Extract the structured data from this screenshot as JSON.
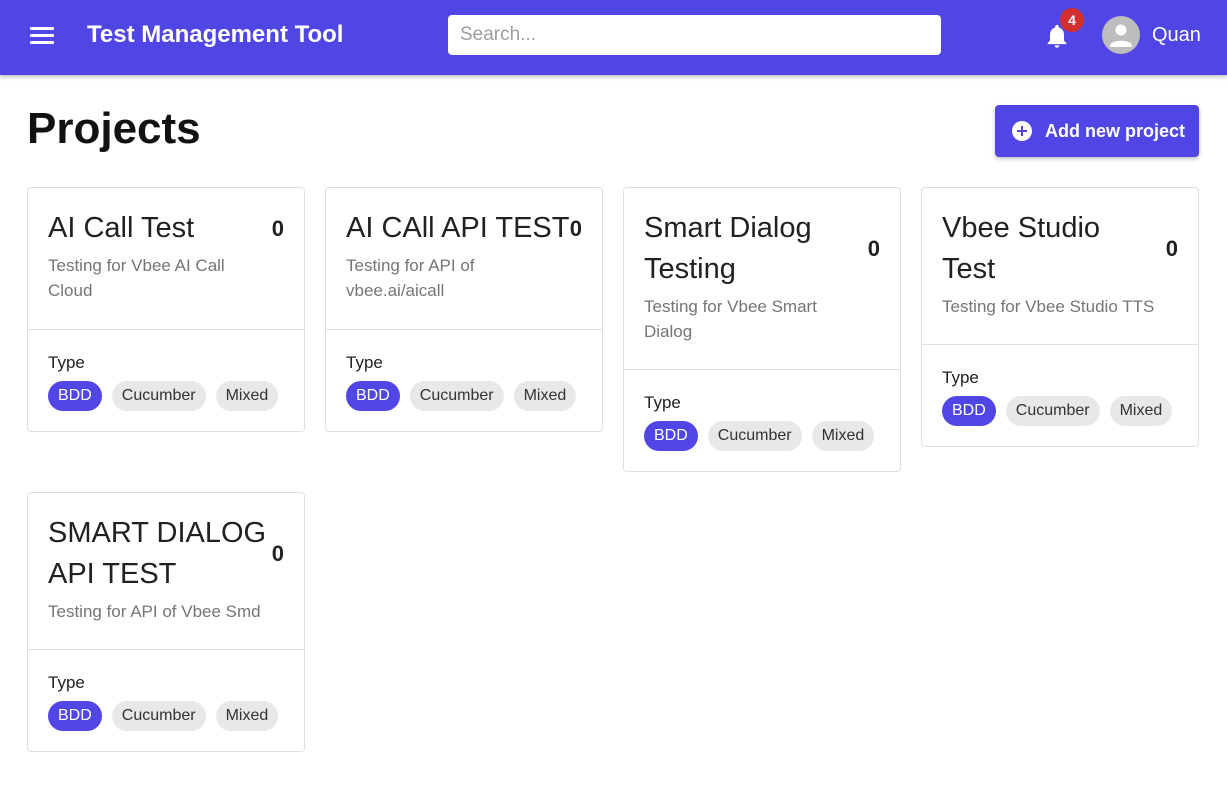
{
  "appbar": {
    "title": "Test Management Tool",
    "search_placeholder": "Search...",
    "notification_count": "4",
    "user_name": "Quan",
    "color": "#4f46e5"
  },
  "page": {
    "title": "Projects",
    "add_button_label": "Add new project"
  },
  "projects": [
    {
      "title": "AI Call Test",
      "count": "0",
      "description": "Testing for Vbee AI Call Cloud",
      "type_label": "Type",
      "tags": [
        "BDD",
        "Cucumber",
        "Mixed"
      ]
    },
    {
      "title": "AI CAll API TEST",
      "count": "0",
      "description": "Testing for API of vbee.ai/aicall",
      "type_label": "Type",
      "tags": [
        "BDD",
        "Cucumber",
        "Mixed"
      ]
    },
    {
      "title": "Smart Dialog Testing",
      "count": "0",
      "description": "Testing for Vbee Smart Dialog",
      "type_label": "Type",
      "tags": [
        "BDD",
        "Cucumber",
        "Mixed"
      ]
    },
    {
      "title": "Vbee Studio Test",
      "count": "0",
      "description": "Testing for Vbee Studio TTS",
      "type_label": "Type",
      "tags": [
        "BDD",
        "Cucumber",
        "Mixed"
      ]
    },
    {
      "title": "SMART DIALOG API TEST",
      "count": "0",
      "description": "Testing for API of Vbee Smd",
      "type_label": "Type",
      "tags": [
        "BDD",
        "Cucumber",
        "Mixed"
      ]
    }
  ],
  "icons": {
    "menu": "menu-icon",
    "notifications": "bell-icon",
    "avatar": "account-circle-icon",
    "add": "add-circle-icon"
  }
}
